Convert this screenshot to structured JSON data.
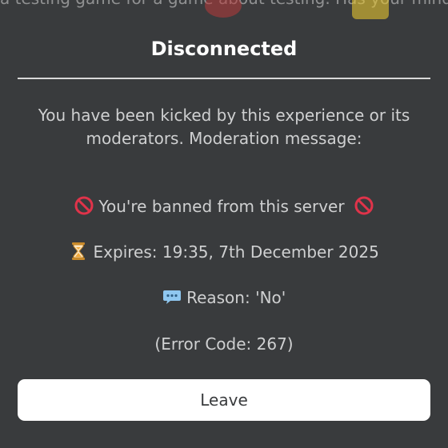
{
  "background": {
    "partial_text": "a testing game for a game about testing. Has your mind exploded yet?"
  },
  "dialog": {
    "title": "Disconnected",
    "message": "You have been kicked by this experience or its moderators. Moderation message:",
    "ban_line": "You're banned from this server",
    "expires_line": "Expires: 19:35, 7th December 2025",
    "reason_line": "Reason: 'No'",
    "error_code": "(Error Code: 267)",
    "leave_label": "Leave"
  },
  "icons": {
    "ban": "no-entry-icon",
    "expires": "hourglass-icon",
    "reason": "speech-bubble-icon"
  },
  "colors": {
    "background": "#393b3d",
    "text": "#cfd0d1",
    "title": "#ffffff",
    "button": "#ffffff",
    "no_entry": "#e0334a",
    "hourglass": "#f2a93b",
    "bubble": "#8fc7f0"
  }
}
